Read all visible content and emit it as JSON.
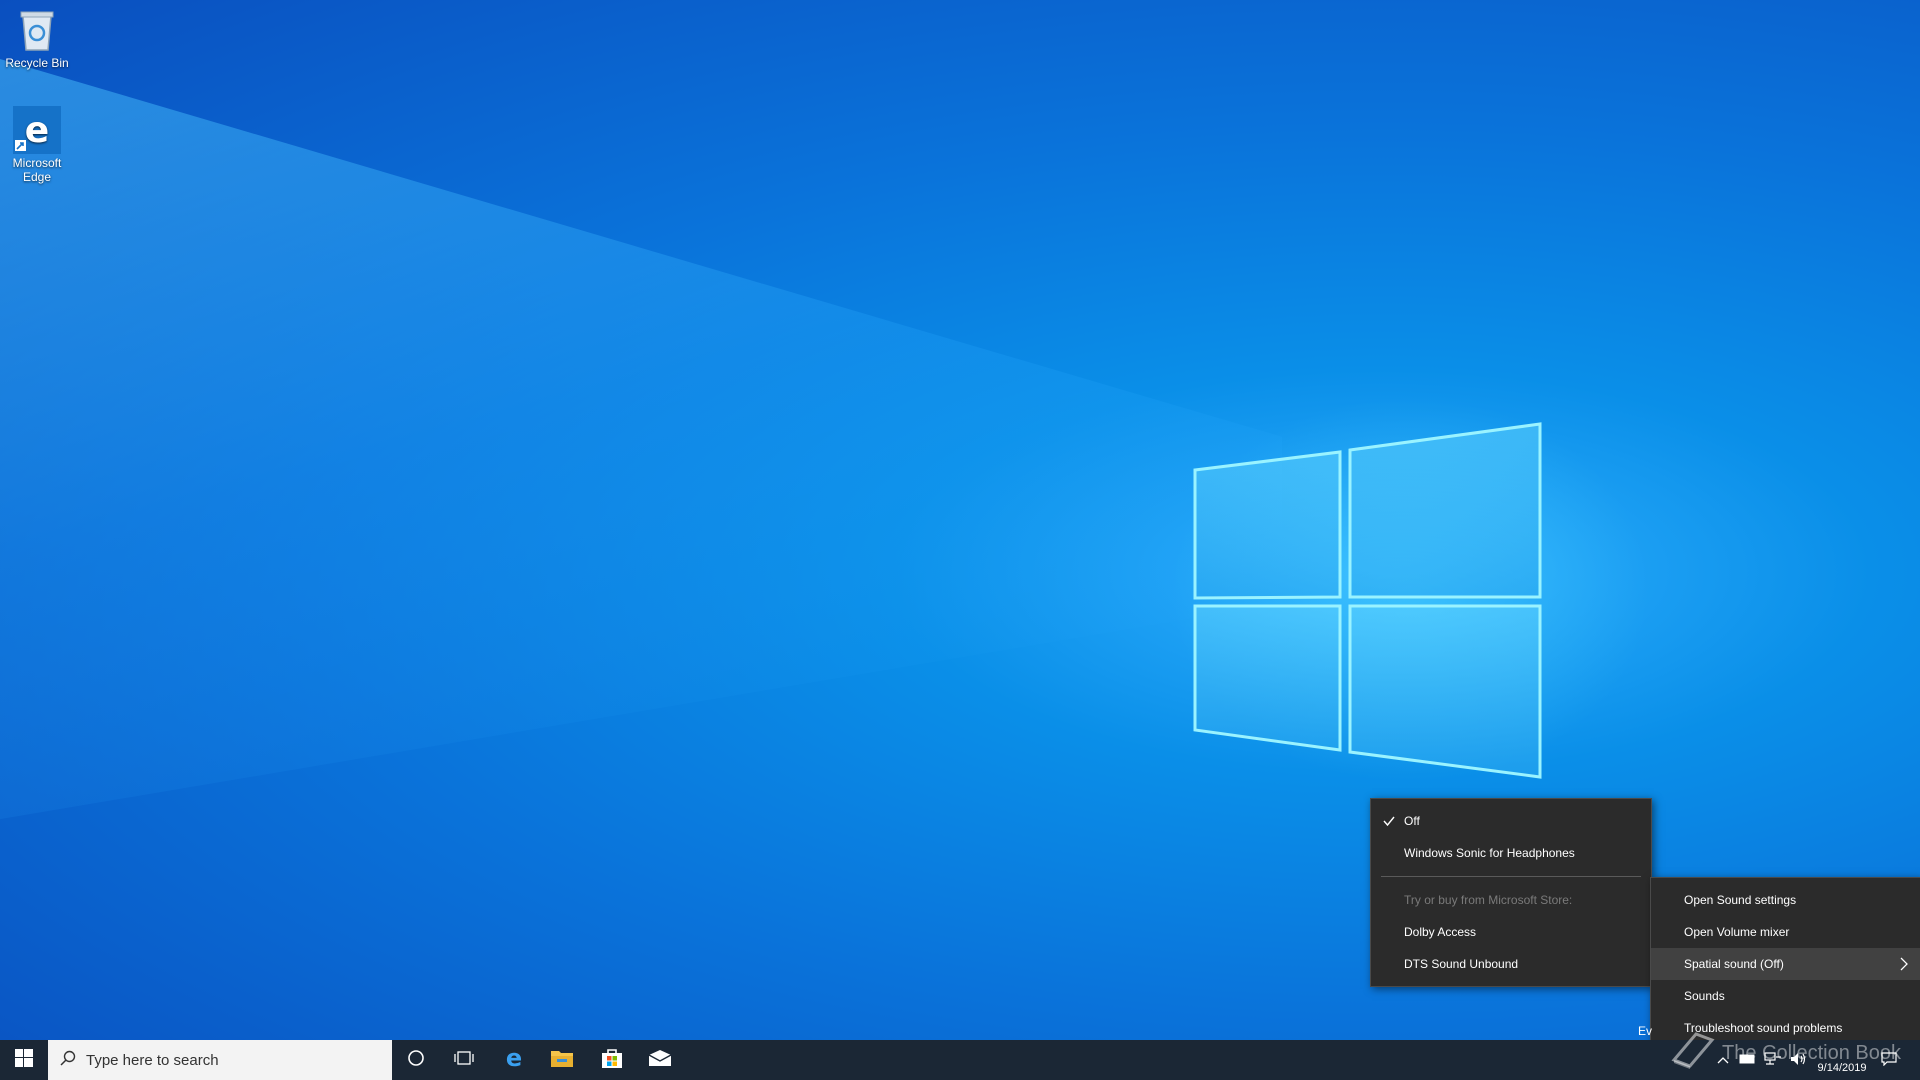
{
  "desktop": {
    "icons": [
      {
        "label": "Recycle Bin"
      },
      {
        "label": "Microsoft Edge"
      }
    ]
  },
  "spatial_menu": {
    "items": [
      {
        "label": "Off",
        "checked": true
      },
      {
        "label": "Windows Sonic for Headphones"
      },
      {
        "label": "Try or buy from Microsoft Store:",
        "disabled": true
      },
      {
        "label": "Dolby Access"
      },
      {
        "label": "DTS Sound Unbound"
      }
    ]
  },
  "volume_menu": {
    "items": [
      {
        "label": "Open Sound settings"
      },
      {
        "label": "Open Volume mixer"
      },
      {
        "label": "Spatial sound (Off)",
        "highlighted": true,
        "has_submenu": true
      },
      {
        "label": "Sounds"
      },
      {
        "label": "Troubleshoot sound problems"
      }
    ]
  },
  "taskbar": {
    "search_placeholder": "Type here to search",
    "pinned": [
      "start-icon",
      "cortana-icon",
      "task-view-icon",
      "edge-icon",
      "file-explorer-icon",
      "store-icon",
      "mail-icon"
    ],
    "tray": {
      "date": "9/14/2019"
    }
  },
  "overlay": {
    "partial_text": "Ev",
    "watermark": "The Collection Book"
  },
  "colors": {
    "taskbar": "#1b2735",
    "menu_bg": "#2b2b2b",
    "menu_hover": "#414141",
    "accent": "#0078d7"
  }
}
